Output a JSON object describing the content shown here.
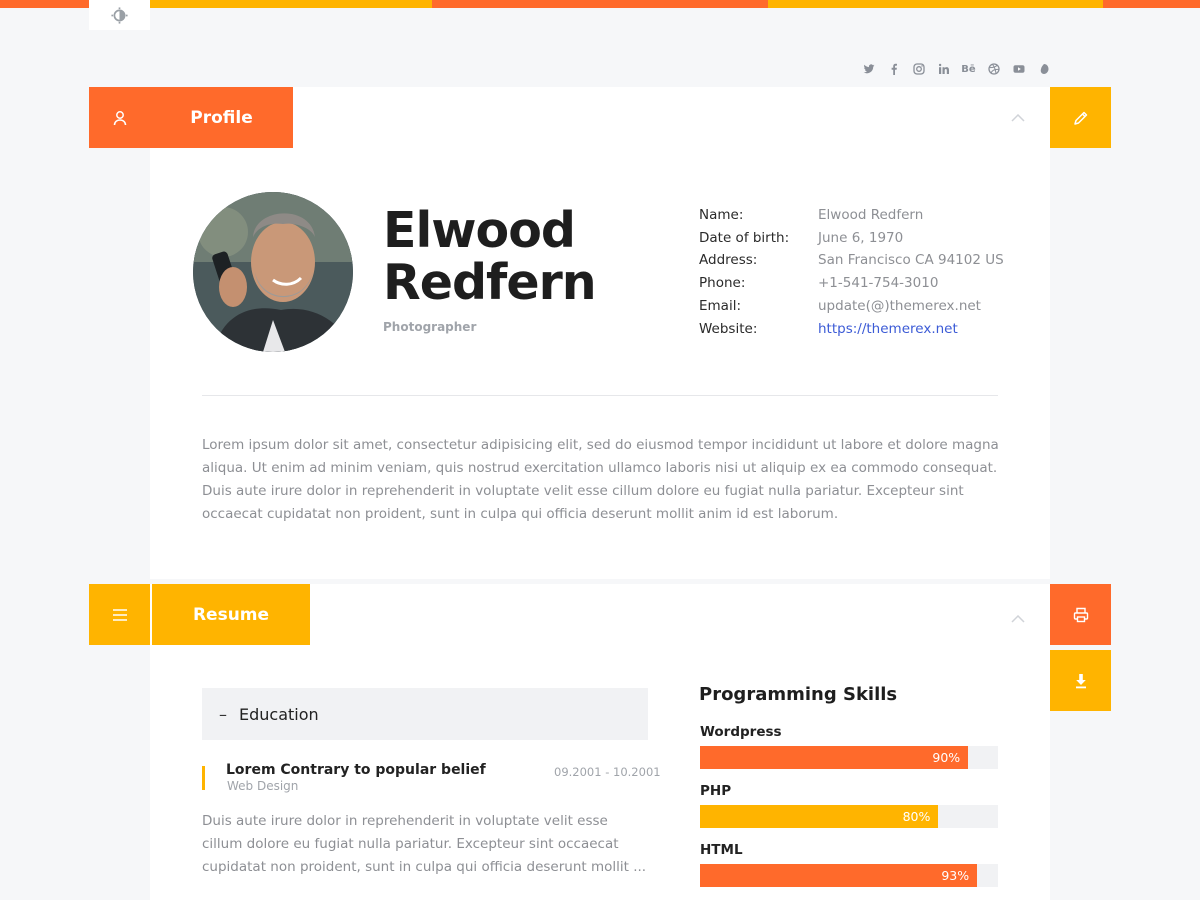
{
  "colors": {
    "accent_orange": "#ff6a2b",
    "accent_yellow": "#ffb400",
    "background": "#f6f7f9"
  },
  "toolbar": {
    "theme_icon": "contrast-icon"
  },
  "social": [
    "twitter",
    "facebook",
    "instagram",
    "linkedin",
    "Bē",
    "dribbble",
    "youtube",
    "tumblr"
  ],
  "profile": {
    "tab_label": "Profile",
    "name_line1": "Elwood",
    "name_line2": "Redfern",
    "role": "Photographer",
    "info": [
      {
        "key": "Name:",
        "value": "Elwood Redfern"
      },
      {
        "key": "Date of birth:",
        "value": "June 6, 1970"
      },
      {
        "key": "Address:",
        "value": "San Francisco CA 94102 US"
      },
      {
        "key": "Phone:",
        "value": "+1-541-754-3010"
      },
      {
        "key": "Email:",
        "value": "update(@)themerex.net"
      },
      {
        "key": "Website:",
        "value": "https://themerex.net"
      }
    ],
    "bio": "Lorem ipsum dolor sit amet, consectetur adipisicing elit, sed do eiusmod tempor incididunt ut labore et dolore magna aliqua. Ut enim ad minim veniam, quis nostrud exercitation ullamco laboris nisi ut aliquip ex ea commodo consequat. Duis aute irure dolor in reprehenderit in voluptate velit esse cillum dolore eu fugiat nulla pariatur. Excepteur sint occaecat cupidatat non proident, sunt in culpa qui officia deserunt mollit anim id est laborum."
  },
  "resume": {
    "tab_label": "Resume",
    "education": {
      "heading": "Education",
      "toggle": "–",
      "item_title": "Lorem Contrary to popular belief",
      "item_subtitle": "Web Design",
      "item_dates": "09.2001 - 10.2001",
      "item_text": "Duis aute irure dolor in reprehenderit in voluptate velit esse cillum dolore eu fugiat nulla pariatur. Excepteur sint occaecat cupidatat non proident, sunt in culpa qui officia deserunt mollit ..."
    },
    "skills": {
      "title": "Programming Skills",
      "items": [
        {
          "label": "Wordpress",
          "percent": 90,
          "percent_text": "90%",
          "color": "#ff6a2b"
        },
        {
          "label": "PHP",
          "percent": 80,
          "percent_text": "80%",
          "color": "#ffb400"
        },
        {
          "label": "HTML",
          "percent": 93,
          "percent_text": "93%",
          "color": "#ff6a2b"
        }
      ]
    }
  }
}
